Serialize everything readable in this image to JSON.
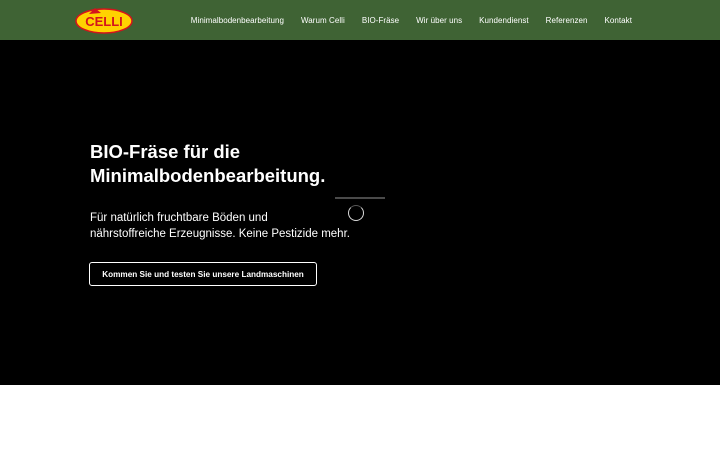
{
  "header": {
    "logo_text": "CELLI",
    "nav": [
      {
        "label": "Minimalbodenbearbeitung"
      },
      {
        "label": "Warum Celli"
      },
      {
        "label": "BIO-Fräse"
      },
      {
        "label": "Wir über uns"
      },
      {
        "label": "Kundendienst"
      },
      {
        "label": "Referenzen"
      },
      {
        "label": "Kontakt"
      }
    ]
  },
  "hero": {
    "title_line1": "BIO-Fräse für die",
    "title_line2": "Minimalbodenbearbeitung.",
    "subtitle_line1": "Für natürlich fruchtbare Böden und",
    "subtitle_line2": "nährstoffreiche Erzeugnisse. Keine Pestizide mehr.",
    "cta_label": "Kommen Sie und testen Sie unsere Landmaschinen"
  },
  "colors": {
    "header_bg": "#3f6334",
    "hero_bg": "#000000",
    "logo_red": "#d4141c",
    "logo_yellow": "#ffd200"
  }
}
